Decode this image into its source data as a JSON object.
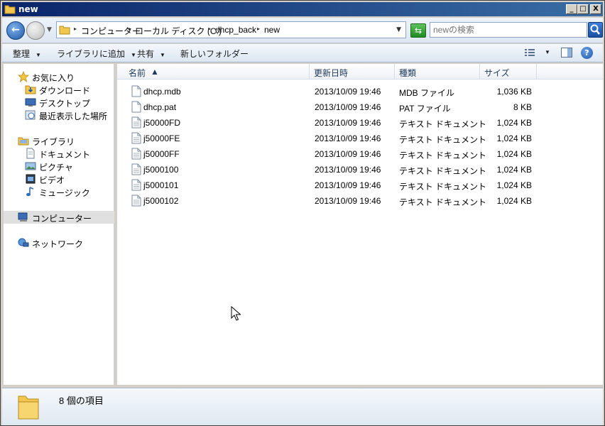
{
  "window": {
    "title": "new",
    "buttons": {
      "minimize": "_",
      "maximize": "□",
      "close": "X"
    }
  },
  "address": {
    "crumbs": [
      "コンピューター",
      "ローカル ディスク (C:)",
      "dhcp_back",
      "new"
    ],
    "search_placeholder": "newの検索"
  },
  "toolbar": {
    "organize": "整理",
    "add_to_library": "ライブラリに追加",
    "share": "共有",
    "new_folder": "新しいフォルダー",
    "help": "?"
  },
  "nav": {
    "favorites": "お気に入り",
    "downloads": "ダウンロード",
    "desktop": "デスクトップ",
    "recent": "最近表示した場所",
    "libraries": "ライブラリ",
    "documents": "ドキュメント",
    "pictures": "ピクチャ",
    "videos": "ビデオ",
    "music": "ミュージック",
    "computer": "コンピューター",
    "network": "ネットワーク"
  },
  "columns": {
    "name": "名前",
    "date": "更新日時",
    "type": "種類",
    "size": "サイズ"
  },
  "files": [
    {
      "name": "dhcp.mdb",
      "date": "2013/10/09 19:46",
      "type": "MDB ファイル",
      "size": "1,036 KB"
    },
    {
      "name": "dhcp.pat",
      "date": "2013/10/09 19:46",
      "type": "PAT ファイル",
      "size": "8 KB"
    },
    {
      "name": "j50000FD",
      "date": "2013/10/09 19:46",
      "type": "テキスト ドキュメント",
      "size": "1,024 KB"
    },
    {
      "name": "j50000FE",
      "date": "2013/10/09 19:46",
      "type": "テキスト ドキュメント",
      "size": "1,024 KB"
    },
    {
      "name": "j50000FF",
      "date": "2013/10/09 19:46",
      "type": "テキスト ドキュメント",
      "size": "1,024 KB"
    },
    {
      "name": "j5000100",
      "date": "2013/10/09 19:46",
      "type": "テキスト ドキュメント",
      "size": "1,024 KB"
    },
    {
      "name": "j5000101",
      "date": "2013/10/09 19:46",
      "type": "テキスト ドキュメント",
      "size": "1,024 KB"
    },
    {
      "name": "j5000102",
      "date": "2013/10/09 19:46",
      "type": "テキスト ドキュメント",
      "size": "1,024 KB"
    }
  ],
  "status": {
    "item_count": "8 個の項目"
  },
  "colors": {
    "titlebar": "#0a246a",
    "selection": "#e0e0e0",
    "header_text": "#1e395b"
  }
}
